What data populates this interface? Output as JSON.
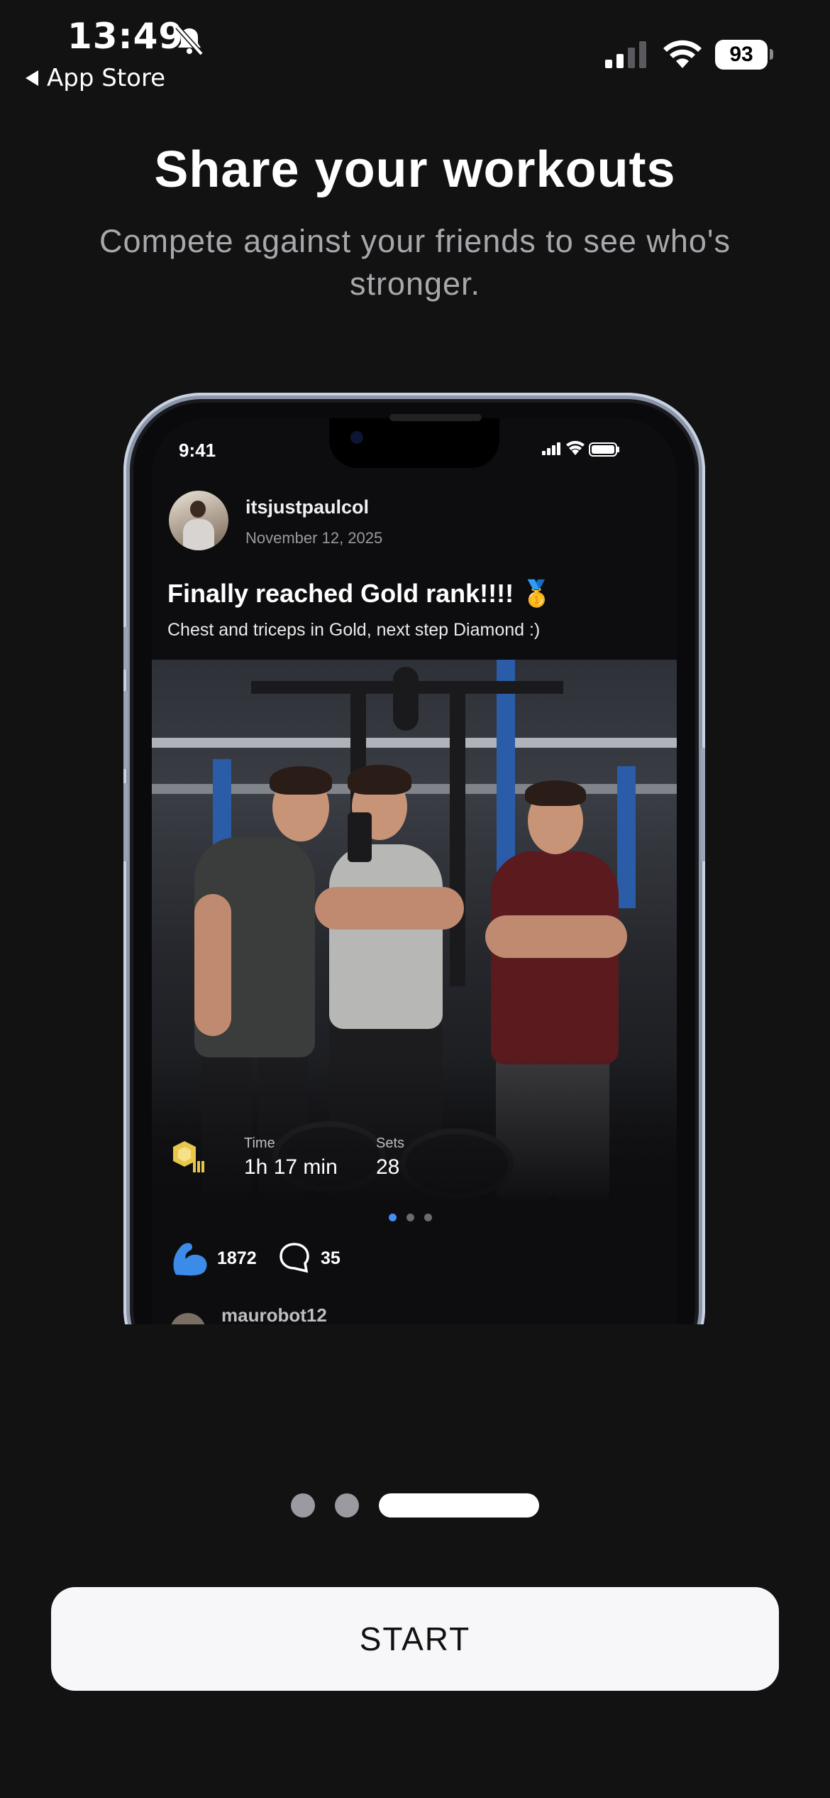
{
  "status_bar": {
    "time": "13:49",
    "back_label": "App Store",
    "battery": "93"
  },
  "onboarding": {
    "title": "Share your workouts",
    "subtitle": "Compete against your friends to see who's stronger.",
    "page_index": 3,
    "page_count": 3,
    "start_label": "START"
  },
  "mockup": {
    "status_time": "9:41",
    "post": {
      "username": "itsjustpaulcol",
      "date": "November 12, 2025",
      "title": "Finally reached Gold rank!!!! 🥇",
      "caption": "Chest and triceps in Gold, next step Diamond :)",
      "time_label": "Time",
      "time_value": "1h 17 min",
      "sets_label": "Sets",
      "sets_value": "28",
      "likes": "1872",
      "comments": "35",
      "photo_index": 1,
      "photo_count": 3
    },
    "next_post_username": "maurobot12"
  },
  "colors": {
    "background": "#121213",
    "subtitle": "#a8a8ac",
    "button_bg": "#f7f7f9",
    "accent_blue": "#4a8cf5",
    "rank_gold": "#e8c74a"
  }
}
